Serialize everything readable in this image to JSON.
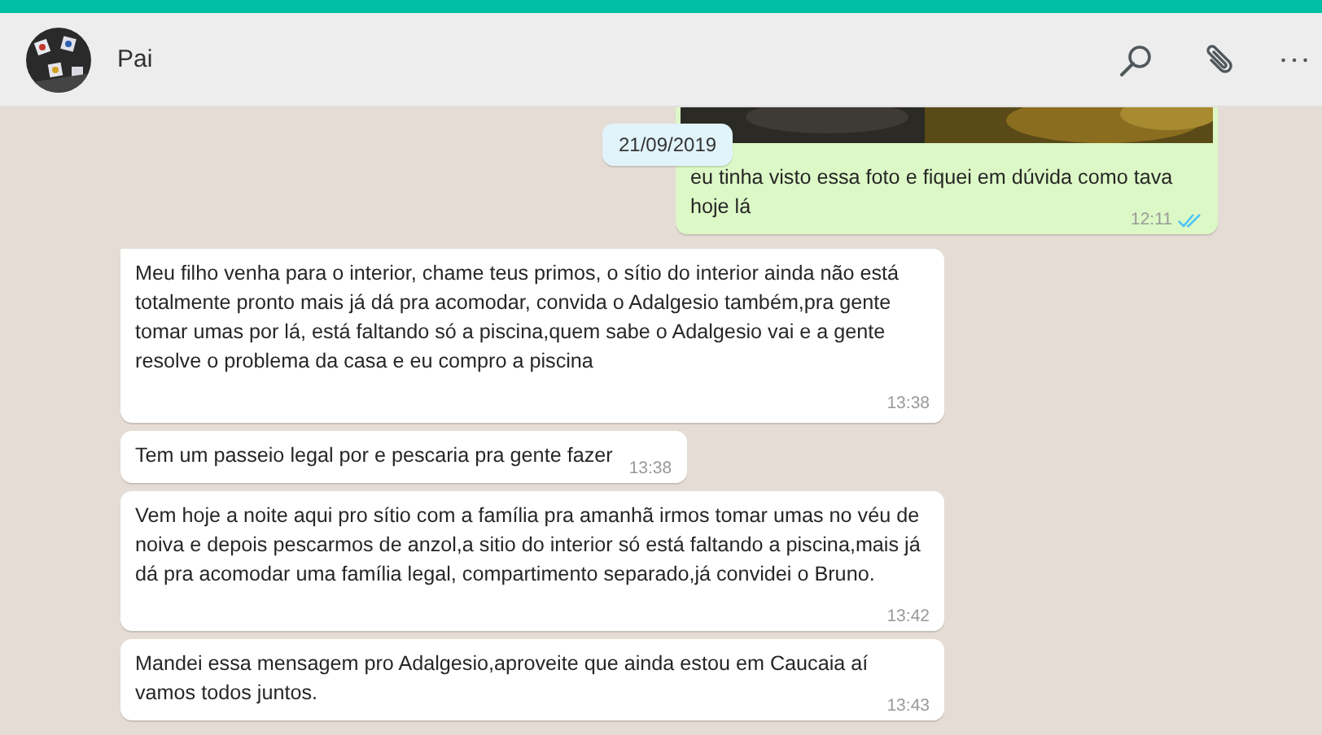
{
  "header": {
    "contact_name": "Pai"
  },
  "date_chip": "21/09/2019",
  "messages": [
    {
      "kind": "outgoing",
      "photo": true,
      "text": "eu tinha visto essa foto e fiquei em dúvida como tava hoje lá",
      "time": "12:11",
      "read": true
    },
    {
      "kind": "incoming",
      "text": "Meu filho venha para o interior, chame teus primos, o sítio do interior ainda não está totalmente pronto mais já dá pra acomodar, convida o Adalgesio também,pra gente tomar umas por lá, está faltando só a piscina,quem sabe o Adalgesio vai e a gente resolve o problema da casa e eu compro a piscina",
      "time": "13:38"
    },
    {
      "kind": "incoming",
      "text": "Tem um passeio legal por e pescaria pra gente fazer",
      "time": "13:38"
    },
    {
      "kind": "incoming",
      "text": "Vem hoje a noite aqui pro sítio com a família pra amanhã irmos tomar umas no véu de noiva e depois pescarmos de anzol,a sitio do interior só está faltando a piscina,mais já dá pra acomodar uma família legal, compartimento separado,já convidei o Bruno.",
      "time": "13:42"
    },
    {
      "kind": "incoming",
      "text": "Mandei essa mensagem pro Adalgesio,aproveite que ainda estou em Caucaia aí vamos todos juntos.",
      "time": "13:43"
    }
  ]
}
